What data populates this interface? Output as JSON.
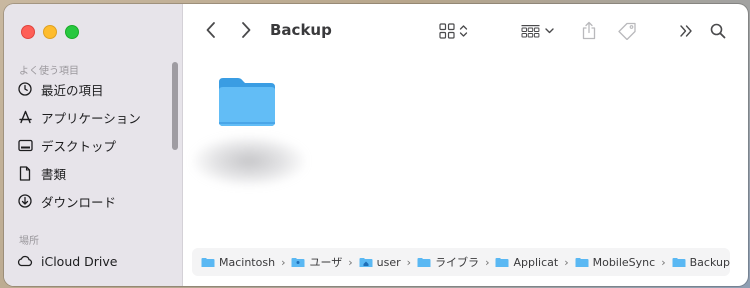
{
  "window": {
    "title": "Backup"
  },
  "sidebar": {
    "sections": [
      {
        "label": "よく使う項目"
      },
      {
        "label": "場所"
      }
    ],
    "favorites": [
      {
        "label": "最近の項目",
        "icon": "clock-icon"
      },
      {
        "label": "アプリケーション",
        "icon": "applications-icon"
      },
      {
        "label": "デスクトップ",
        "icon": "desktop-icon"
      },
      {
        "label": "書類",
        "icon": "document-icon"
      },
      {
        "label": "ダウンロード",
        "icon": "download-icon"
      }
    ],
    "locations": [
      {
        "label": "iCloud Drive",
        "icon": "cloud-icon"
      }
    ]
  },
  "pathbar": {
    "crumbs": [
      {
        "label": "Macintosh"
      },
      {
        "label": "ユーザ"
      },
      {
        "label": "user"
      },
      {
        "label": "ライブラ"
      },
      {
        "label": "Applicat"
      },
      {
        "label": "MobileSync"
      },
      {
        "label": "Backup"
      }
    ]
  },
  "colors": {
    "folder": "#5ab8f3",
    "folder_dark": "#3a9de3",
    "accent": "#1e7cf3"
  }
}
